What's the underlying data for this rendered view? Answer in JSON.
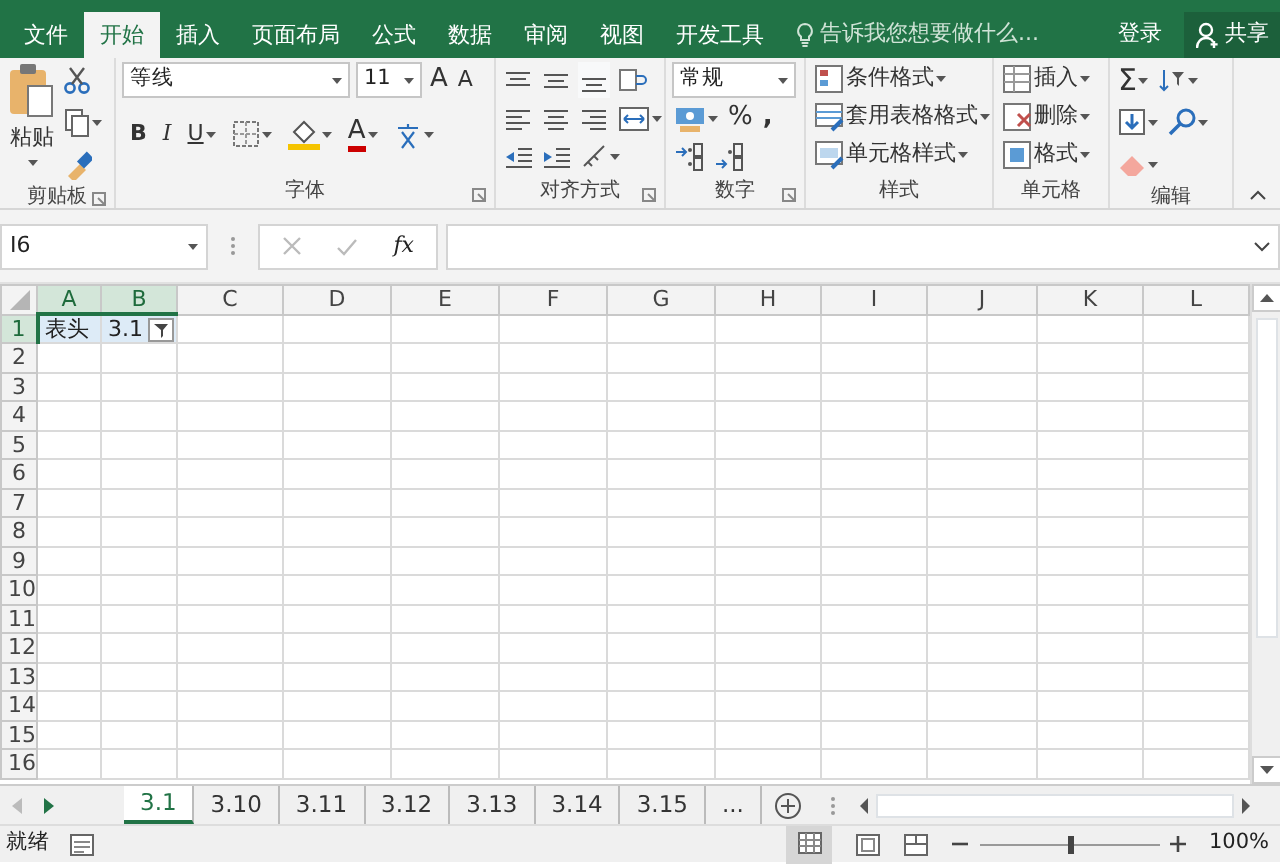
{
  "menu_tabs": [
    {
      "label": "文件",
      "selected": false
    },
    {
      "label": "开始",
      "selected": true
    },
    {
      "label": "插入",
      "selected": false
    },
    {
      "label": "页面布局",
      "selected": false
    },
    {
      "label": "公式",
      "selected": false
    },
    {
      "label": "数据",
      "selected": false
    },
    {
      "label": "审阅",
      "selected": false
    },
    {
      "label": "视图",
      "selected": false
    },
    {
      "label": "开发工具",
      "selected": false
    }
  ],
  "tell_me": {
    "placeholder": "告诉我您想要做什么..."
  },
  "account": {
    "sign_in": "登录",
    "share": "共享"
  },
  "ribbon": {
    "clipboard": {
      "name": "剪贴板",
      "paste": "粘贴"
    },
    "font": {
      "name": "字体",
      "font_name": "等线",
      "font_size": "11",
      "grow": "A",
      "shrink": "A",
      "bold": "B",
      "italic": "I",
      "underline": "U",
      "font_color": "A"
    },
    "alignment": {
      "name": "对齐方式"
    },
    "number": {
      "name": "数字",
      "format": "常规",
      "percent": "%",
      "comma": ","
    },
    "styles": {
      "name": "样式",
      "buttons": [
        "条件格式",
        "套用表格格式",
        "单元格样式"
      ]
    },
    "cells": {
      "name": "单元格",
      "buttons": [
        "插入",
        "删除",
        "格式"
      ]
    },
    "editing": {
      "name": "编辑",
      "sum": "Σ"
    }
  },
  "formula_bar": {
    "name_box": "I6",
    "fx": "fx"
  },
  "columns": [
    {
      "label": "A",
      "selected": true
    },
    {
      "label": "B",
      "selected": true
    },
    {
      "label": "C",
      "selected": false
    },
    {
      "label": "D",
      "selected": false
    },
    {
      "label": "E",
      "selected": false
    },
    {
      "label": "F",
      "selected": false
    },
    {
      "label": "G",
      "selected": false
    },
    {
      "label": "H",
      "selected": false
    },
    {
      "label": "I",
      "selected": false
    },
    {
      "label": "J",
      "selected": false
    },
    {
      "label": "K",
      "selected": false
    },
    {
      "label": "L",
      "selected": false
    }
  ],
  "rows": [
    {
      "label": "1",
      "selected": true,
      "cells": [
        {
          "text": "表头",
          "filter": false
        },
        {
          "text": "3.1",
          "filter": true
        }
      ]
    },
    {
      "label": "2",
      "selected": false
    },
    {
      "label": "3",
      "selected": false
    },
    {
      "label": "4",
      "selected": false
    },
    {
      "label": "5",
      "selected": false
    },
    {
      "label": "6",
      "selected": false
    },
    {
      "label": "7",
      "selected": false
    },
    {
      "label": "8",
      "selected": false
    },
    {
      "label": "9",
      "selected": false
    },
    {
      "label": "10",
      "selected": false
    },
    {
      "label": "11",
      "selected": false
    },
    {
      "label": "12",
      "selected": false
    },
    {
      "label": "13",
      "selected": false
    },
    {
      "label": "14",
      "selected": false
    },
    {
      "label": "15",
      "selected": false
    },
    {
      "label": "16",
      "selected": false
    }
  ],
  "sheet_tabs": [
    {
      "label": "3.1",
      "selected": true
    },
    {
      "label": "3.10",
      "selected": false
    },
    {
      "label": "3.11",
      "selected": false
    },
    {
      "label": "3.12",
      "selected": false
    },
    {
      "label": "3.13",
      "selected": false
    },
    {
      "label": "3.14",
      "selected": false
    },
    {
      "label": "3.15",
      "selected": false
    }
  ],
  "more_sheets": "...",
  "status_bar": {
    "status": "就绪",
    "zoom": "100%",
    "level": 0.5
  }
}
